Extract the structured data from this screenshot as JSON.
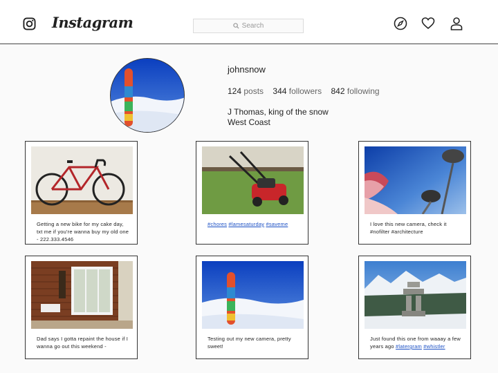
{
  "app": {
    "wordmark": "Instagram"
  },
  "search": {
    "placeholder": "Search"
  },
  "nav": {
    "icons": [
      "compass-icon",
      "heart-icon",
      "person-icon"
    ]
  },
  "profile": {
    "username": "johnsnow",
    "posts_count": "124",
    "posts_label": "posts",
    "followers_count": "344",
    "followers_label": "followers",
    "following_count": "842",
    "following_label": "following",
    "bio_line1": "J Thomas, king of the snow",
    "bio_line2": "West Coast"
  },
  "posts": [
    {
      "caption": "Getting a new bike for my cake day, txt me if you're wanna buy my old one - 222.333.4546",
      "tags": []
    },
    {
      "caption": "",
      "tags": [
        "#chores",
        "#lamesaturday",
        "#saveme"
      ]
    },
    {
      "caption": "I love this new camera, check it #nofilter #architecture",
      "tags": []
    },
    {
      "caption": "Dad says I gotta repaint the house if I wanna go out this weekend -",
      "tags": []
    },
    {
      "caption": "Testing out my new camera, pretty sweet!",
      "tags": []
    },
    {
      "caption": "Just found this one from waaay a few years ago",
      "tags": [
        "#latergram",
        "#whistler"
      ]
    }
  ],
  "colors": {
    "link": "#1a4fc4",
    "border": "#333333"
  }
}
